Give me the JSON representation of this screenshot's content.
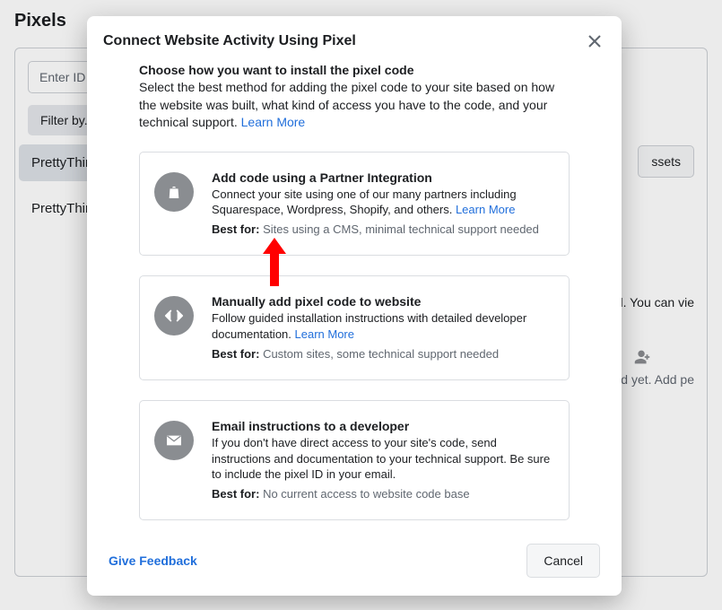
{
  "background": {
    "page_title": "Pixels",
    "search_placeholder": "Enter ID / As",
    "filter_label": "Filter by...",
    "list_items": [
      "PrettyThings",
      "PrettyThings"
    ],
    "assets_button": "ssets",
    "right_snippet_1": "Pixel. You can vie",
    "add_people_snippet": "nected yet. Add pe"
  },
  "modal": {
    "title": "Connect Website Activity Using Pixel",
    "intro_title": "Choose how you want to install the pixel code",
    "intro_text": "Select the best method for adding the pixel code to your site based on how the website was built, what kind of access you have to the code, and your technical support. ",
    "learn_more": "Learn More",
    "options": [
      {
        "title": "Add code using a Partner Integration",
        "desc": "Connect your site using one of our many partners including Squarespace, Wordpress, Shopify, and others. ",
        "learn_more": "Learn More",
        "best_label": "Best for:",
        "best_text": " Sites using a CMS, minimal technical support needed"
      },
      {
        "title": "Manually add pixel code to website",
        "desc": "Follow guided installation instructions with detailed developer documentation. ",
        "learn_more": "Learn More",
        "best_label": "Best for:",
        "best_text": " Custom sites, some technical support needed"
      },
      {
        "title": "Email instructions to a developer",
        "desc": "If you don't have direct access to your site's code, send instructions and documentation to your technical support. Be sure to include the pixel ID in your email.",
        "learn_more": "",
        "best_label": "Best for:",
        "best_text": " No current access to website code base"
      }
    ],
    "feedback": "Give Feedback",
    "cancel": "Cancel"
  }
}
